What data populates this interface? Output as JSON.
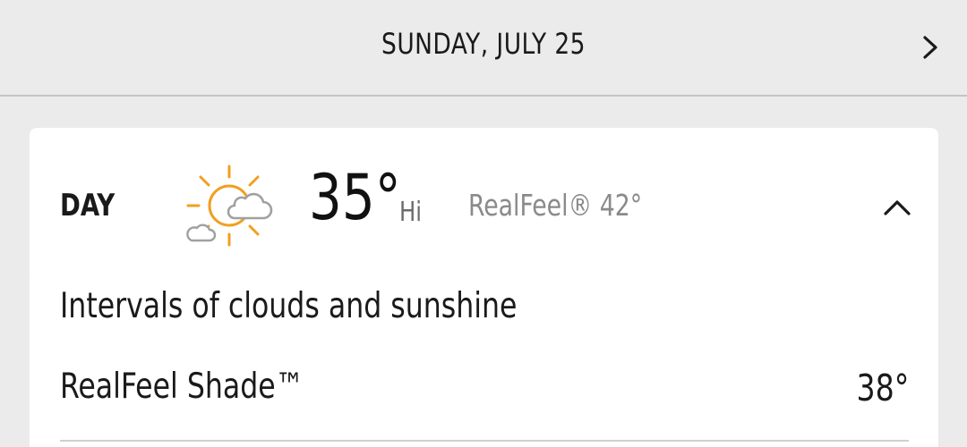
{
  "header": {
    "date": "SUNDAY, JULY 25",
    "next_icon": "chevron-right-icon"
  },
  "day_card": {
    "period_label": "DAY",
    "icon": "partly-sunny-icon",
    "temperature": "35°",
    "temperature_suffix": "Hi",
    "realfeel": "RealFeel® 42°",
    "toggle_icon": "chevron-up-icon",
    "phrase": "Intervals of clouds and sunshine",
    "details": [
      {
        "label": "RealFeel Shade™",
        "value": "38°"
      }
    ]
  },
  "colors": {
    "background": "#ebebeb",
    "card": "#ffffff",
    "sun": "#f0a020",
    "cloud": "#a0a0a0",
    "secondary_text": "#8a8a8a"
  }
}
